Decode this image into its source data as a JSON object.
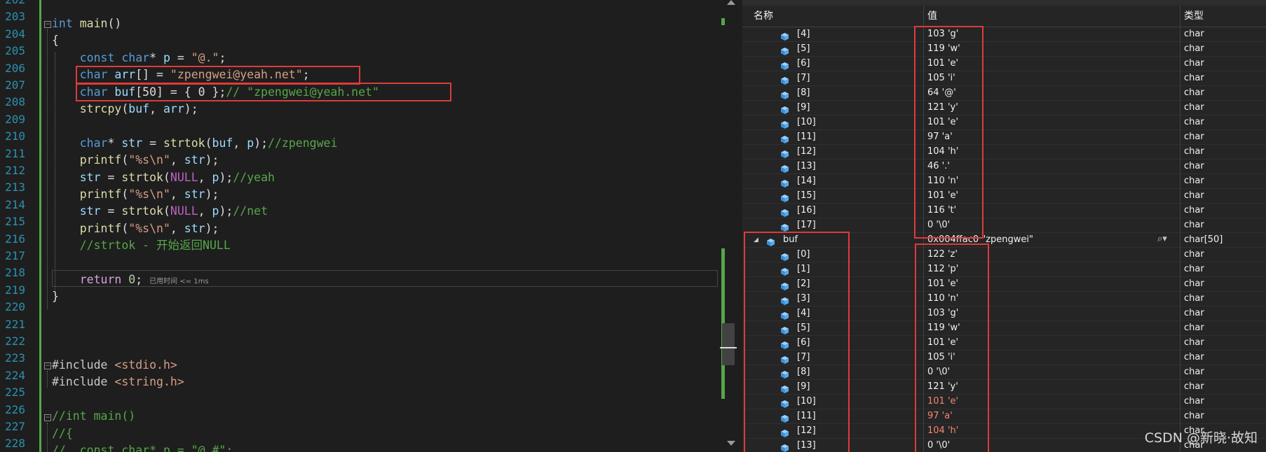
{
  "editor": {
    "line_numbers": [
      "202",
      "203",
      "204",
      "205",
      "206",
      "207",
      "208",
      "209",
      "210",
      "211",
      "212",
      "213",
      "214",
      "215",
      "216",
      "217",
      "218",
      "219",
      "220",
      "221",
      "222",
      "223",
      "224",
      "225",
      "226",
      "227",
      "228"
    ],
    "code": {
      "l203_kw": "int",
      "l203_fn": "main",
      "l203_p": "()",
      "l204": "{",
      "l205_a": "const ",
      "l205_b": "char",
      "l205_c": "* ",
      "l205_d": "p",
      "l205_e": " = ",
      "l205_f": "\"@.\"",
      "l205_g": ";",
      "l206_a": "char ",
      "l206_b": "arr",
      "l206_c": "[] = ",
      "l206_d": "\"zpengwei@yeah.net\"",
      "l206_e": ";",
      "l207_a": "char ",
      "l207_b": "buf",
      "l207_c": "[50] = { 0 };",
      "l207_d": "// \"zpengwei@yeah.net\"",
      "l208_a": "strcpy",
      "l208_b": "(",
      "l208_c": "buf",
      "l208_d": ", ",
      "l208_e": "arr",
      "l208_f": ");",
      "l210_a": "char",
      "l210_b": "* ",
      "l210_c": "str",
      "l210_d": " = ",
      "l210_e": "strtok",
      "l210_f": "(",
      "l210_g": "buf",
      "l210_h": ", ",
      "l210_i": "p",
      "l210_j": ");",
      "l210_k": "//zpengwei",
      "l211_a": "printf",
      "l211_b": "(",
      "l211_c": "\"%s\\n\"",
      "l211_d": ", ",
      "l211_e": "str",
      "l211_f": ");",
      "l212_a": "str",
      "l212_b": " = ",
      "l212_c": "strtok",
      "l212_d": "(",
      "l212_e": "NULL",
      "l212_f": ", ",
      "l212_g": "p",
      "l212_h": ");",
      "l212_i": "//yeah",
      "l213_a": "printf",
      "l213_b": "(",
      "l213_c": "\"%s\\n\"",
      "l213_d": ", ",
      "l213_e": "str",
      "l213_f": ");",
      "l214_a": "str",
      "l214_b": " = ",
      "l214_c": "strtok",
      "l214_d": "(",
      "l214_e": "NULL",
      "l214_f": ", ",
      "l214_g": "p",
      "l214_h": ");",
      "l214_i": "//net",
      "l215_a": "printf",
      "l215_b": "(",
      "l215_c": "\"%s\\n\"",
      "l215_d": ", ",
      "l215_e": "str",
      "l215_f": ");",
      "l216": "//strtok - 开始返回NULL",
      "l218_a": "return ",
      "l218_b": "0",
      "l218_c": ";",
      "l218_elapsed": "已用时间 <= 1ms",
      "l219": "}",
      "l223_a": "#include ",
      "l223_b": "<stdio.h>",
      "l224_a": "#include ",
      "l224_b": "<string.h>",
      "l226": "//int main()",
      "l227": "//{",
      "l228": "//  const char* p = \"@.#\";"
    }
  },
  "watch": {
    "headers": {
      "name": "名称",
      "value": "值",
      "type": "类型"
    },
    "arr_rows": [
      {
        "name": "[4]",
        "value": "103 'g'",
        "type": "char"
      },
      {
        "name": "[5]",
        "value": "119 'w'",
        "type": "char"
      },
      {
        "name": "[6]",
        "value": "101 'e'",
        "type": "char"
      },
      {
        "name": "[7]",
        "value": "105 'i'",
        "type": "char"
      },
      {
        "name": "[8]",
        "value": "64 '@'",
        "type": "char"
      },
      {
        "name": "[9]",
        "value": "121 'y'",
        "type": "char"
      },
      {
        "name": "[10]",
        "value": "101 'e'",
        "type": "char"
      },
      {
        "name": "[11]",
        "value": "97 'a'",
        "type": "char"
      },
      {
        "name": "[12]",
        "value": "104 'h'",
        "type": "char"
      },
      {
        "name": "[13]",
        "value": "46 '.'",
        "type": "char"
      },
      {
        "name": "[14]",
        "value": "110 'n'",
        "type": "char"
      },
      {
        "name": "[15]",
        "value": "101 'e'",
        "type": "char"
      },
      {
        "name": "[16]",
        "value": "116 't'",
        "type": "char"
      },
      {
        "name": "[17]",
        "value": "0 '\\0'",
        "type": "char"
      }
    ],
    "buf_row": {
      "name": "buf",
      "value": "0x004ffac0 \"zpengwei\"",
      "type": "char[50]"
    },
    "buf_rows": [
      {
        "name": "[0]",
        "value": "122 'z'",
        "type": "char"
      },
      {
        "name": "[1]",
        "value": "112 'p'",
        "type": "char"
      },
      {
        "name": "[2]",
        "value": "101 'e'",
        "type": "char"
      },
      {
        "name": "[3]",
        "value": "110 'n'",
        "type": "char"
      },
      {
        "name": "[4]",
        "value": "103 'g'",
        "type": "char"
      },
      {
        "name": "[5]",
        "value": "119 'w'",
        "type": "char"
      },
      {
        "name": "[6]",
        "value": "101 'e'",
        "type": "char"
      },
      {
        "name": "[7]",
        "value": "105 'i'",
        "type": "char"
      },
      {
        "name": "[8]",
        "value": "0 '\\0'",
        "type": "char"
      },
      {
        "name": "[9]",
        "value": "121 'y'",
        "type": "char"
      },
      {
        "name": "[10]",
        "value": "101 'e'",
        "type": "char",
        "changed": true
      },
      {
        "name": "[11]",
        "value": "97 'a'",
        "type": "char",
        "changed": true
      },
      {
        "name": "[12]",
        "value": "104 'h'",
        "type": "char",
        "changed": true
      },
      {
        "name": "[13]",
        "value": "0 '\\0'",
        "type": "char"
      }
    ],
    "watermark": "CSDN @新晓·故知"
  },
  "colors": {
    "red_box": "#e03a3a",
    "changed_value": "#f48771",
    "keyword": "#569cd6",
    "comment": "#57a64a"
  }
}
